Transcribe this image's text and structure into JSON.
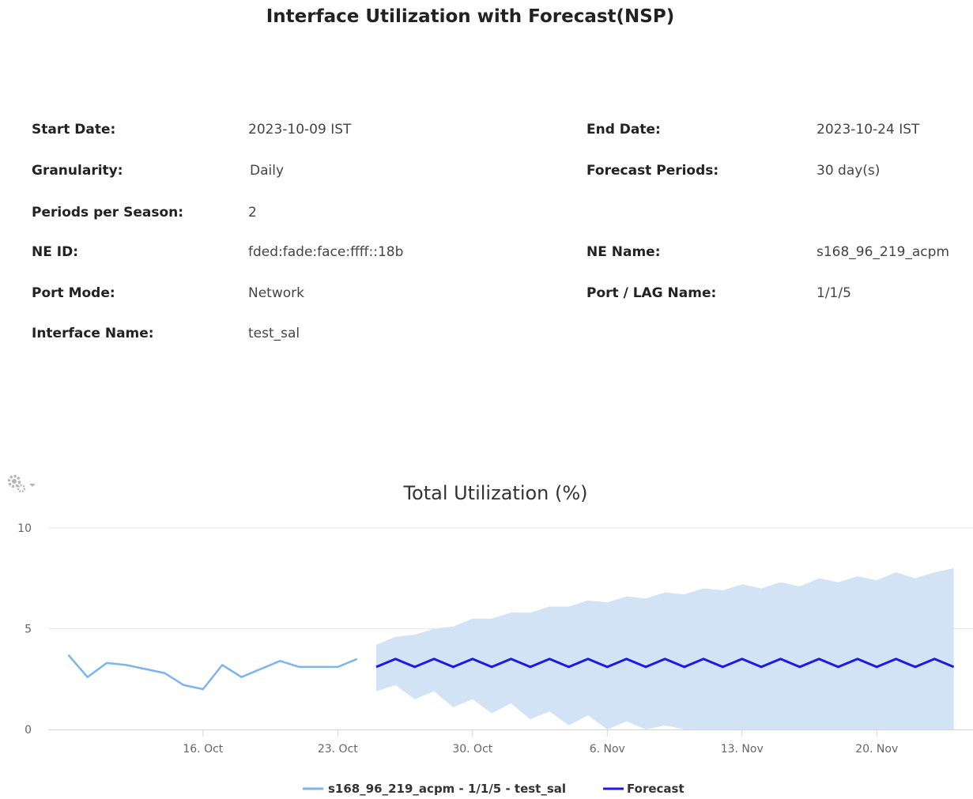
{
  "report": {
    "title": "Interface Utilization with Forecast(NSP)",
    "fields": [
      {
        "label": "Start Date:",
        "value": "2023-10-09 IST"
      },
      {
        "label": "End Date:",
        "value": "2023-10-24 IST"
      },
      {
        "label": "Granularity:",
        "value": "Daily"
      },
      {
        "label": "Forecast Periods:",
        "value": "30 day(s)"
      },
      {
        "label": "Periods per Season:",
        "value": "2"
      },
      {
        "label": "NE ID:",
        "value": "fded:fade:face:ffff::18b"
      },
      {
        "label": "NE Name:",
        "value": "s168_96_219_acpm"
      },
      {
        "label": "Port Mode:",
        "value": "Network"
      },
      {
        "label": "Port / LAG Name:",
        "value": "1/1/5"
      },
      {
        "label": "Interface Name:",
        "value": "test_sal"
      }
    ]
  },
  "toolbar": {
    "settings_icon": "gear-icon"
  },
  "chart_data": {
    "type": "line",
    "title": "Total Utilization (%)",
    "xlabel": "",
    "ylabel": "",
    "xlim": [
      "2023-10-08",
      "2023-11-25"
    ],
    "ylim": [
      0,
      10
    ],
    "y_ticks": [
      0,
      5,
      10
    ],
    "x_ticks": [
      {
        "date": "2023-10-16",
        "label": "16. Oct"
      },
      {
        "date": "2023-10-23",
        "label": "23. Oct"
      },
      {
        "date": "2023-10-30",
        "label": "30. Oct"
      },
      {
        "date": "2023-11-06",
        "label": "6. Nov"
      },
      {
        "date": "2023-11-13",
        "label": "13. Nov"
      },
      {
        "date": "2023-11-20",
        "label": "20. Nov"
      }
    ],
    "grid": true,
    "legend_position": "bottom-center",
    "series": [
      {
        "name": "s168_96_219_acpm - 1/1/5 - test_sal",
        "color": "#7cb5ec",
        "x": [
          "2023-10-09",
          "2023-10-10",
          "2023-10-11",
          "2023-10-12",
          "2023-10-13",
          "2023-10-14",
          "2023-10-15",
          "2023-10-16",
          "2023-10-17",
          "2023-10-18",
          "2023-10-19",
          "2023-10-20",
          "2023-10-21",
          "2023-10-22",
          "2023-10-23",
          "2023-10-24"
        ],
        "values": [
          3.7,
          2.6,
          3.3,
          3.2,
          3.0,
          2.8,
          2.2,
          2.0,
          3.2,
          2.6,
          3.0,
          3.4,
          3.1,
          3.1,
          3.1,
          3.5
        ]
      },
      {
        "name": "Forecast",
        "color": "#1a1ae6",
        "band_color": "#d2e3f6",
        "x": [
          "2023-10-25",
          "2023-10-26",
          "2023-10-27",
          "2023-10-28",
          "2023-10-29",
          "2023-10-30",
          "2023-10-31",
          "2023-11-01",
          "2023-11-02",
          "2023-11-03",
          "2023-11-04",
          "2023-11-05",
          "2023-11-06",
          "2023-11-07",
          "2023-11-08",
          "2023-11-09",
          "2023-11-10",
          "2023-11-11",
          "2023-11-12",
          "2023-11-13",
          "2023-11-14",
          "2023-11-15",
          "2023-11-16",
          "2023-11-17",
          "2023-11-18",
          "2023-11-19",
          "2023-11-20",
          "2023-11-21",
          "2023-11-22",
          "2023-11-23",
          "2023-11-24"
        ],
        "values": [
          3.1,
          3.5,
          3.1,
          3.5,
          3.1,
          3.5,
          3.1,
          3.5,
          3.1,
          3.5,
          3.1,
          3.5,
          3.1,
          3.5,
          3.1,
          3.5,
          3.1,
          3.5,
          3.1,
          3.5,
          3.1,
          3.5,
          3.1,
          3.5,
          3.1,
          3.5,
          3.1,
          3.5,
          3.1,
          3.5,
          3.1
        ],
        "upper": [
          4.2,
          4.6,
          4.7,
          5.0,
          5.1,
          5.5,
          5.5,
          5.8,
          5.8,
          6.1,
          6.1,
          6.4,
          6.3,
          6.6,
          6.5,
          6.8,
          6.7,
          7.0,
          6.9,
          7.2,
          7.0,
          7.3,
          7.1,
          7.5,
          7.3,
          7.6,
          7.4,
          7.8,
          7.5,
          7.8,
          8.0
        ],
        "lower": [
          1.9,
          2.2,
          1.5,
          1.9,
          1.1,
          1.5,
          0.8,
          1.3,
          0.5,
          0.9,
          0.2,
          0.7,
          0.0,
          0.4,
          0.0,
          0.2,
          0.0,
          0.0,
          0.0,
          0.0,
          0.0,
          0.0,
          0.0,
          0.0,
          0.0,
          0.0,
          0.0,
          0.0,
          0.0,
          0.0,
          0.0
        ]
      }
    ]
  }
}
